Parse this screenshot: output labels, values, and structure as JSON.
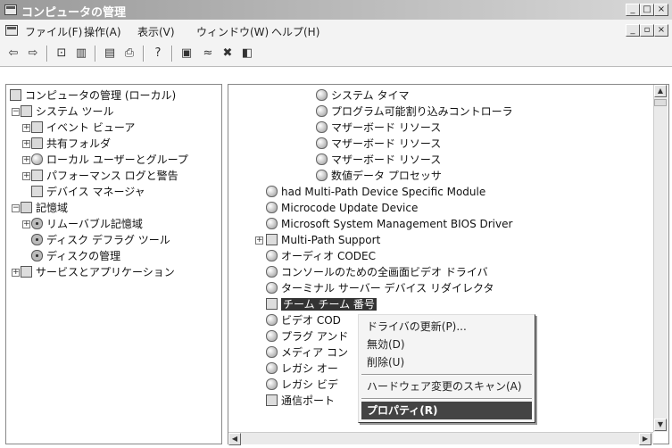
{
  "window": {
    "title": "コンピュータの管理"
  },
  "menubar": {
    "items": [
      "ファイル(F)",
      "操作(A)",
      "表示(V)",
      "ウィンドウ(W)",
      "ヘルプ(H)"
    ]
  },
  "left_tree": {
    "items": [
      "コンピュータの管理 (ローカル)",
      "システム ツール",
      "イベント ビューア",
      "共有フォルダ",
      "ローカル ユーザーとグループ",
      "パフォーマンス ログと警告",
      "デバイス マネージャ",
      "記憶域",
      "リムーバブル記憶域",
      "ディスク デフラグ ツール",
      "ディスクの管理",
      "サービスとアプリケーション"
    ]
  },
  "device_list": {
    "items": [
      "システム タイマ",
      "プログラム可能割り込みコントローラ",
      "マザーボード リソース",
      "マザーボード リソース",
      "マザーボード リソース",
      "数値データ プロセッサ",
      "had Multi-Path Device Specific Module",
      "Microcode Update Device",
      "Microsoft System Management BIOS Driver",
      "Multi-Path Support",
      "オーディオ CODEC",
      "コンソールのための全画面ビデオ ドライバ",
      "ターミナル サーバー デバイス リダイレクタ",
      "チーム チーム 番号",
      "ビデオ COD",
      "プラグ アンド",
      "メディア コン",
      "レガシ オー",
      "レガシ ビデ",
      "通信ポート"
    ]
  },
  "context_menu": {
    "items": [
      "ドライバの更新(P)...",
      "無効(D)",
      "削除(U)",
      "ハードウェア変更のスキャン(A)",
      "プロパティ(R)"
    ]
  }
}
